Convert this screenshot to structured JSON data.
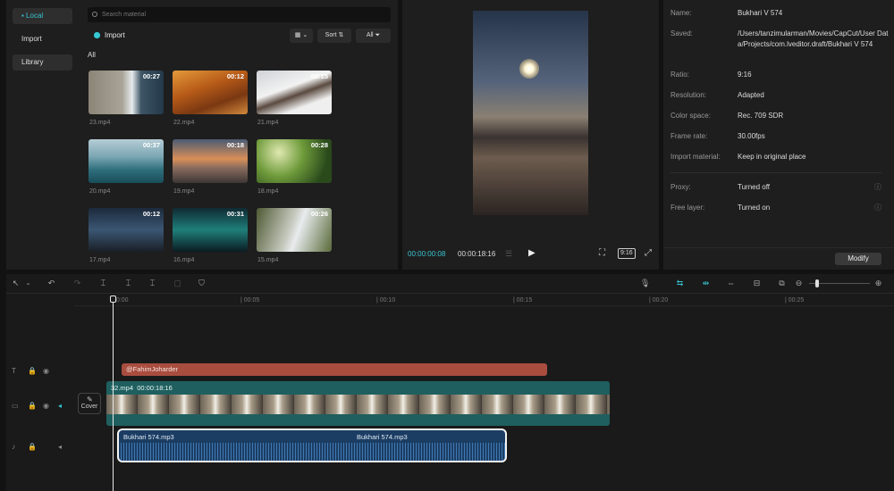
{
  "media": {
    "sidebar": [
      {
        "label": "▪ Local"
      },
      {
        "label": "Import"
      },
      {
        "label": "Library"
      }
    ],
    "search_placeholder": "Search material",
    "import_label": "Import",
    "sort_label": "Sort",
    "all_filter_label": "All",
    "section_label": "All",
    "items": [
      {
        "name": "23.mp4",
        "duration": "00:27"
      },
      {
        "name": "22.mp4",
        "duration": "00:12"
      },
      {
        "name": "21.mp4",
        "duration": "00:15"
      },
      {
        "name": "20.mp4",
        "duration": "00:37"
      },
      {
        "name": "19.mp4",
        "duration": "00:18"
      },
      {
        "name": "18.mp4",
        "duration": "00:28"
      },
      {
        "name": "17.mp4",
        "duration": "00:12"
      },
      {
        "name": "16.mp4",
        "duration": "00:31"
      },
      {
        "name": "15.mp4",
        "duration": "00:26"
      }
    ]
  },
  "player": {
    "current_time": "00:00:00:08",
    "total_time": "00:00:18:16",
    "ratio_label": "9:16"
  },
  "details": {
    "rows": [
      {
        "label": "Name:",
        "value": "Bukhari V 574"
      },
      {
        "label": "Saved:",
        "value": "/Users/tanzimularman/Movies/CapCut/User Data/Projects/com.lveditor.draft/Bukhari V 574"
      },
      {
        "label": "Ratio:",
        "value": "9:16"
      },
      {
        "label": "Resolution:",
        "value": "Adapted"
      },
      {
        "label": "Color space:",
        "value": "Rec. 709 SDR"
      },
      {
        "label": "Frame rate:",
        "value": "30.00fps"
      },
      {
        "label": "Import material:",
        "value": "Keep in original place"
      },
      {
        "label": "Proxy:",
        "value": "Turned off"
      },
      {
        "label": "Free layer:",
        "value": "Turned on"
      }
    ],
    "modify_label": "Modify"
  },
  "timeline": {
    "ruler": [
      "00:00",
      "| 00:05",
      "| 00:10",
      "| 00:15",
      "| 00:20",
      "| 00:25"
    ],
    "text_clip": "@FahimJoharder",
    "video_clip": {
      "name": "32.mp4",
      "duration": "00:00:18:16"
    },
    "cover_label": "Cover",
    "audio_clips": [
      "Bukhari 574.mp3",
      "Bukhari 574.mp3"
    ]
  },
  "colors": {
    "accent": "#37c6d2",
    "text_clip": "#a94d3f",
    "video_clip": "#1f5f5f",
    "audio_clip": "#1c3d63"
  }
}
